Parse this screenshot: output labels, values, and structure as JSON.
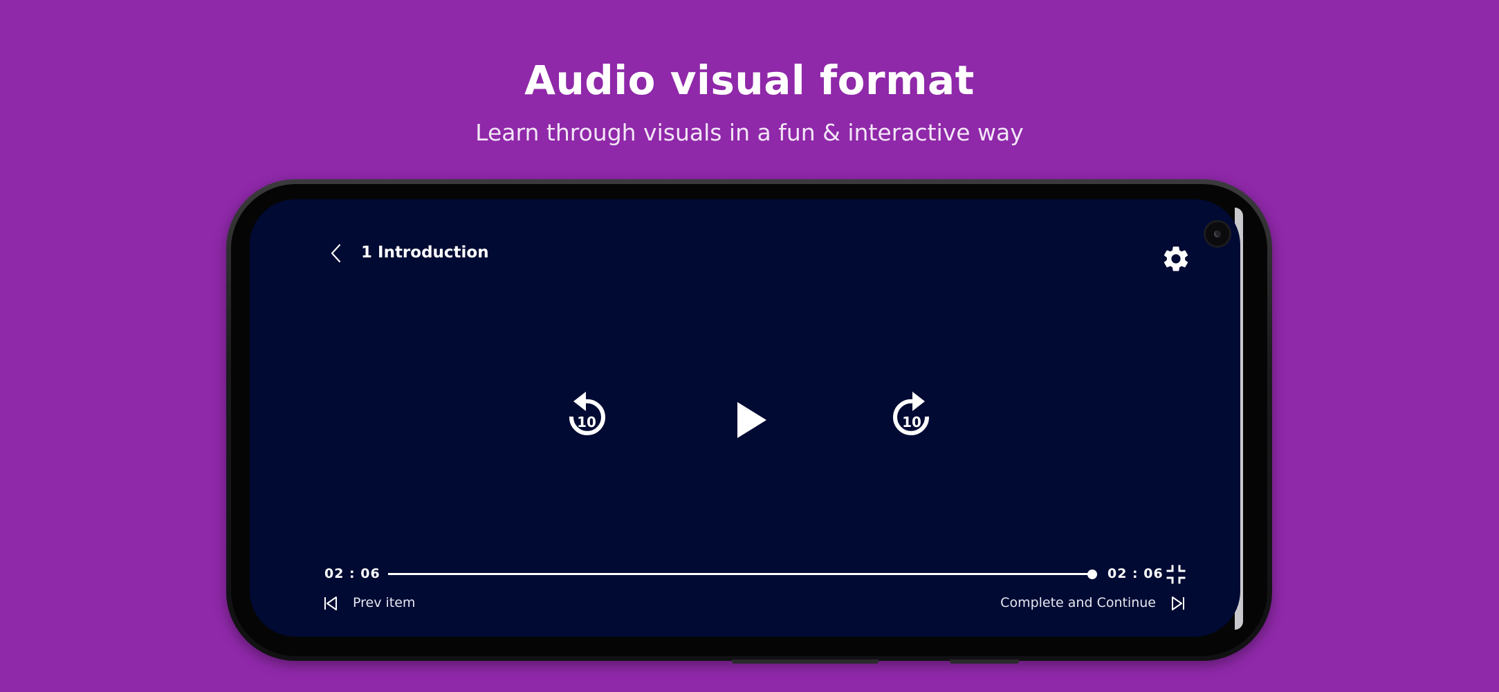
{
  "banner": {
    "title": "Audio visual format",
    "subtitle": "Learn through visuals in a fun & interactive way"
  },
  "player": {
    "lesson_title": "1 Introduction",
    "skip_back_seconds": "10",
    "skip_forward_seconds": "10",
    "time_current": "02 : 06",
    "time_total": "02 : 06",
    "progress": 1.0,
    "prev_label": "Prev item",
    "next_label": "Complete and Continue"
  },
  "icons": {
    "back": "chevron-left-icon",
    "settings": "gear-icon",
    "rewind": "rewind-10-icon",
    "play": "play-icon",
    "forward": "forward-10-icon",
    "exit_fullscreen": "exit-fullscreen-icon",
    "prev": "skip-previous-icon",
    "next": "skip-next-icon"
  },
  "colors": {
    "background": "#8f28a9",
    "screen": "#010a33",
    "text": "#ffffff"
  }
}
